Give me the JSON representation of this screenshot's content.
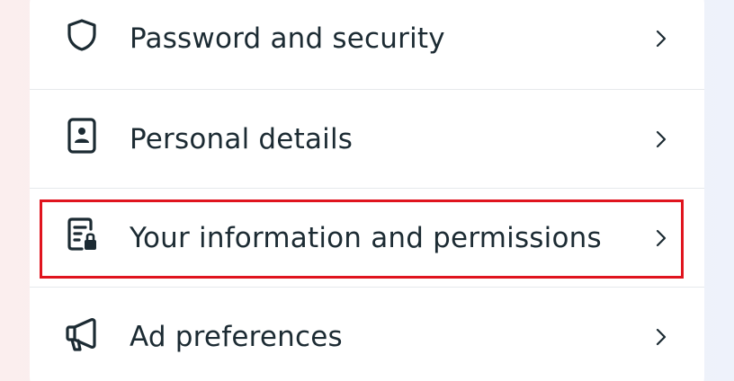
{
  "menu": {
    "items": [
      {
        "label": "Password and security",
        "icon": "shield-icon"
      },
      {
        "label": "Personal details",
        "icon": "id-card-icon"
      },
      {
        "label": "Your information and permissions",
        "icon": "info-lock-icon"
      },
      {
        "label": "Ad preferences",
        "icon": "megaphone-icon"
      }
    ]
  },
  "colors": {
    "text": "#1c2b33",
    "highlight": "#e0141e",
    "divider": "#e6e9ec"
  },
  "highlighted_item": "Your information and permissions"
}
